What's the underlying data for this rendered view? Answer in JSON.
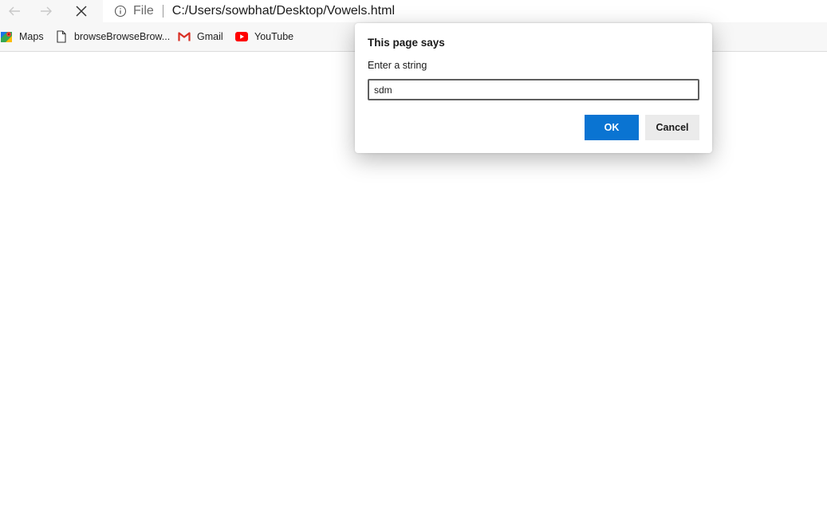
{
  "toolbar": {
    "back_icon": "arrow-left-icon",
    "forward_icon": "arrow-right-icon",
    "stop_icon": "close-icon"
  },
  "address_bar": {
    "info_icon": "info-icon",
    "scheme_label": "File",
    "url": "C:/Users/sowbhat/Desktop/Vowels.html"
  },
  "favorites": [
    {
      "label": "Maps",
      "icon": "maps-icon"
    },
    {
      "label": "browseBrowseBrow...",
      "icon": "page-icon"
    },
    {
      "label": "Gmail",
      "icon": "gmail-icon"
    },
    {
      "label": "YouTube",
      "icon": "youtube-icon"
    }
  ],
  "dialog": {
    "title": "This page says",
    "message": "Enter a string",
    "input_value": "sdm",
    "ok_label": "OK",
    "cancel_label": "Cancel"
  },
  "colors": {
    "ok_button": "#0a74d2",
    "cancel_button": "#ebebeb",
    "youtube_red": "#ff0000",
    "gmail_red": "#d93025"
  }
}
